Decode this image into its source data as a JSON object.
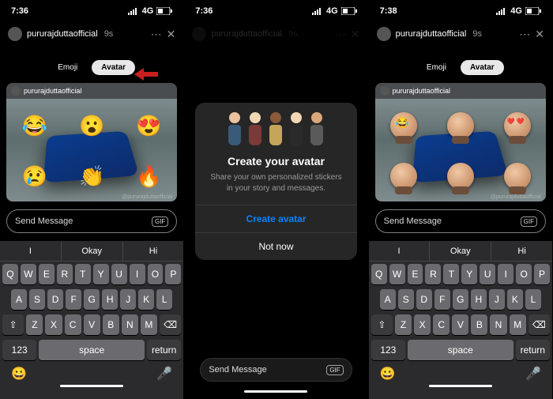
{
  "status": {
    "net_label": "4G"
  },
  "shots": [
    {
      "time": "7:36",
      "username": "pururajduttaofficial",
      "ago": "9s",
      "tabs": {
        "emoji": "Emoji",
        "avatar": "Avatar",
        "active": "avatar"
      },
      "emoji_reactions": [
        "😂",
        "😮",
        "😍",
        "😢",
        "👏",
        "🔥"
      ],
      "watermark": "@pururajduttaofficial",
      "send_placeholder": "Send Message",
      "suggestions": [
        "I",
        "Okay",
        "Hi"
      ]
    },
    {
      "time": "7:36",
      "username": "pururajduttaofficial",
      "ago": "9s",
      "modal": {
        "title": "Create your avatar",
        "body": "Share your own personalized stickers in your story and messages.",
        "primary": "Create avatar",
        "secondary": "Not now"
      },
      "send_placeholder": "Send Message"
    },
    {
      "time": "7:38",
      "username": "pururajduttaofficial",
      "ago": "9s",
      "tabs": {
        "emoji": "Emoji",
        "avatar": "Avatar",
        "active": "avatar"
      },
      "watermark": "@pururajduttaofficial",
      "send_placeholder": "Send Message",
      "suggestions": [
        "I",
        "Okay",
        "Hi"
      ]
    }
  ],
  "keyboard": {
    "row1": [
      "Q",
      "W",
      "E",
      "R",
      "T",
      "Y",
      "U",
      "I",
      "O",
      "P"
    ],
    "row2": [
      "A",
      "S",
      "D",
      "F",
      "G",
      "H",
      "J",
      "K",
      "L"
    ],
    "row3": [
      "Z",
      "X",
      "C",
      "V",
      "B",
      "N",
      "M"
    ],
    "numeric_label": "123",
    "space_label": "space",
    "return_label": "return",
    "gif_label": "GIF"
  }
}
